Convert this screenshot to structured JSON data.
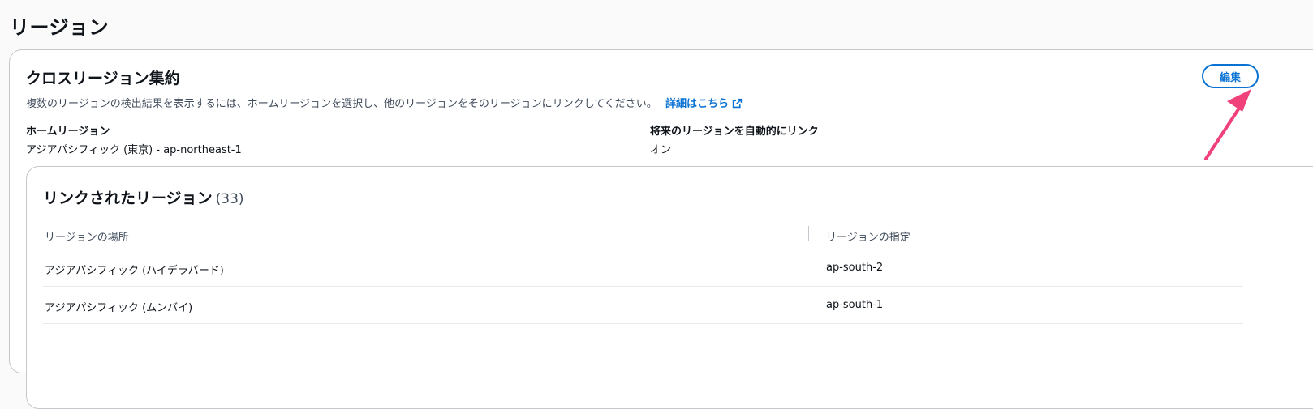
{
  "page": {
    "title": "リージョン"
  },
  "cross_region": {
    "title": "クロスリージョン集約",
    "description": "複数のリージョンの検出結果を表示するには、ホームリージョンを選択し、他のリージョンをそのリージョンにリンクしてください。",
    "learn_more": "詳細はこちら",
    "edit_label": "編集",
    "home_region_label": "ホームリージョン",
    "home_region_value": "アジアパシフィック (東京) - ap-northeast-1",
    "auto_link_label": "将来のリージョンを自動的にリンク",
    "auto_link_value": "オン"
  },
  "linked_regions": {
    "title": "リンクされたリージョン",
    "count": "(33)",
    "columns": {
      "location": "リージョンの場所",
      "code": "リージョンの指定"
    },
    "rows": [
      {
        "location": "アジアパシフィック (ハイデラバード)",
        "code": "ap-south-2"
      },
      {
        "location": "アジアパシフィック (ムンバイ)",
        "code": "ap-south-1"
      }
    ]
  },
  "colors": {
    "accent": "#0972d3",
    "annotation_arrow": "#f0417a"
  },
  "icons": {
    "external_link": "external-link-icon",
    "annotation": "annotation-arrow-icon"
  }
}
